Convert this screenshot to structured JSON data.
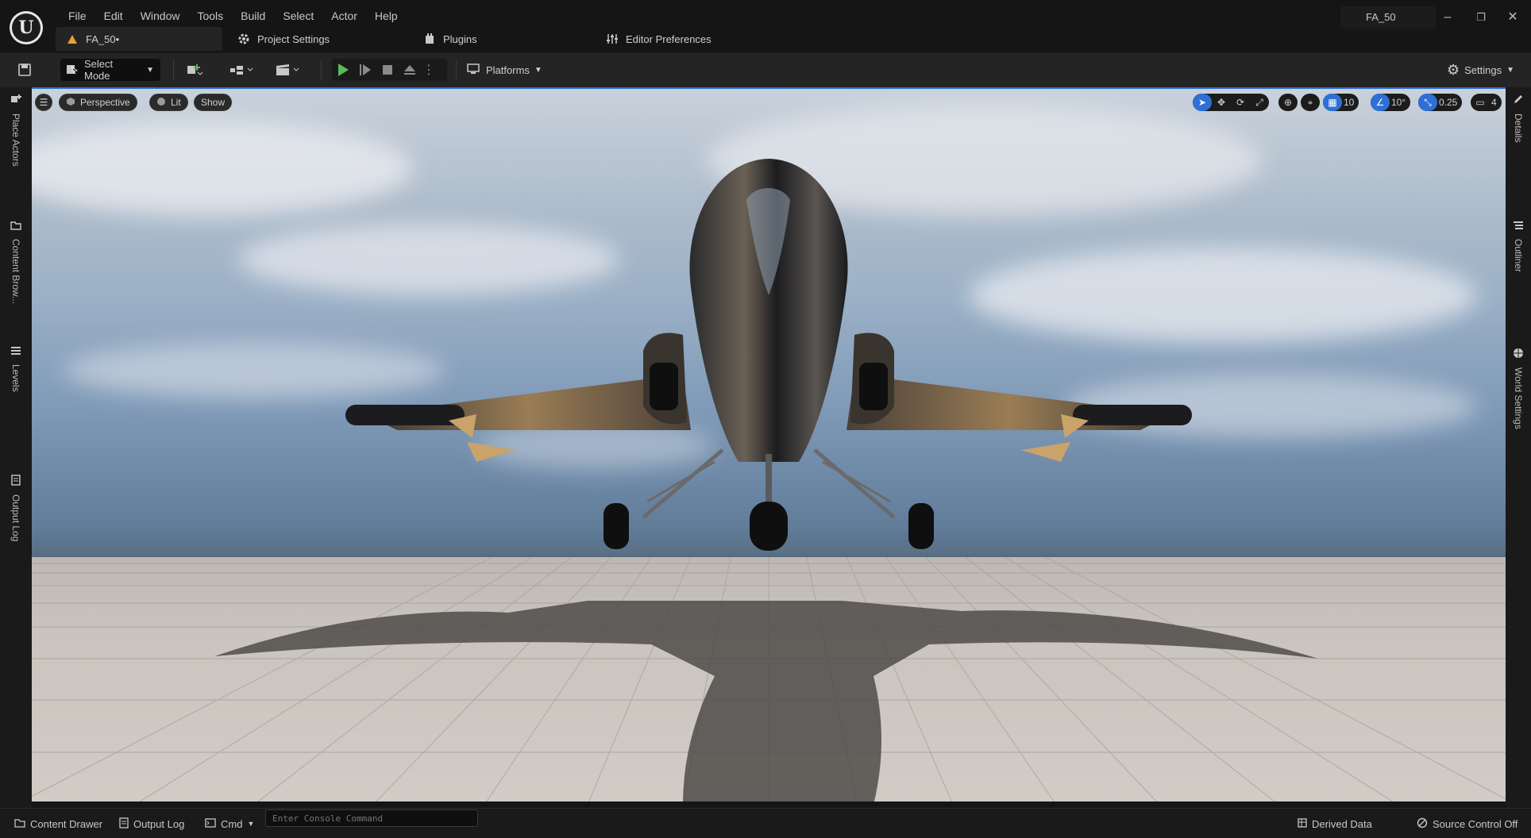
{
  "menu": {
    "items": [
      "File",
      "Edit",
      "Window",
      "Tools",
      "Build",
      "Select",
      "Actor",
      "Help"
    ]
  },
  "project_name": "FA_50",
  "tabs": [
    {
      "label": "FA_50•",
      "icon": "level-warning-icon"
    },
    {
      "label": "Project Settings",
      "icon": "settings-cog-icon"
    },
    {
      "label": "Plugins",
      "icon": "plugin-icon"
    },
    {
      "label": "Editor Preferences",
      "icon": "sliders-icon"
    }
  ],
  "toolbar": {
    "select_mode": "Select Mode",
    "platforms": "Platforms",
    "settings": "Settings"
  },
  "left_panel": {
    "tabs": [
      "Place Actors",
      "Content Brow...",
      "Levels",
      "Output Log"
    ]
  },
  "right_panel": {
    "tabs": [
      "Details",
      "Outliner",
      "World Settings"
    ]
  },
  "viewport": {
    "perspective": "Perspective",
    "lit": "Lit",
    "show": "Show",
    "grid_snap": "10",
    "rotation_snap": "10°",
    "scale_snap": "0.25",
    "camera_speed": "4"
  },
  "statusbar": {
    "content_drawer": "Content Drawer",
    "output_log": "Output Log",
    "cmd": "Cmd",
    "console_placeholder": "Enter Console Command",
    "derived_data": "Derived Data",
    "source_control": "Source Control Off"
  },
  "colors": {
    "accent": "#2f6fd6",
    "play": "#5cb85c",
    "warning": "#e8a030"
  }
}
